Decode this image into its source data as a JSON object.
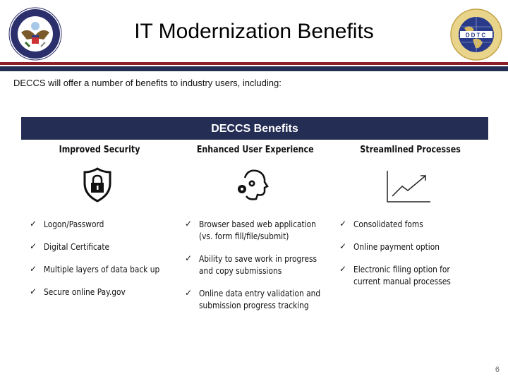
{
  "header": {
    "title": "IT Modernization Benefits",
    "left_seal": "department-of-state-seal",
    "right_seal": "ddtc-seal",
    "right_seal_text": "DDTC"
  },
  "intro": "DECCS will offer a number of benefits to industry users, including:",
  "banner": "DECCS Benefits",
  "columns": [
    {
      "heading": "Improved Security",
      "icon": "shield-lock-icon",
      "items": [
        "Logon/Password",
        "Digital Certificate",
        "Multiple layers of data back up",
        "Secure online Pay.gov"
      ]
    },
    {
      "heading": "Enhanced User Experience",
      "icon": "head-gears-icon",
      "items": [
        [
          "Browser based web application",
          "(vs. form fill/file/submit)"
        ],
        [
          "Ability to save work in progress",
          "and copy submissions"
        ],
        [
          "Online data entry validation and",
          "submission progress tracking"
        ]
      ]
    },
    {
      "heading": "Streamlined Processes",
      "icon": "trend-chart-icon",
      "items": [
        "Consolidated foms",
        "Online payment option",
        [
          "Electronic filing option for",
          "current manual processes"
        ]
      ]
    }
  ],
  "check_glyph": "✓",
  "page_number": "6",
  "colors": {
    "navy": "#242d54",
    "red": "#8b1f2a"
  }
}
